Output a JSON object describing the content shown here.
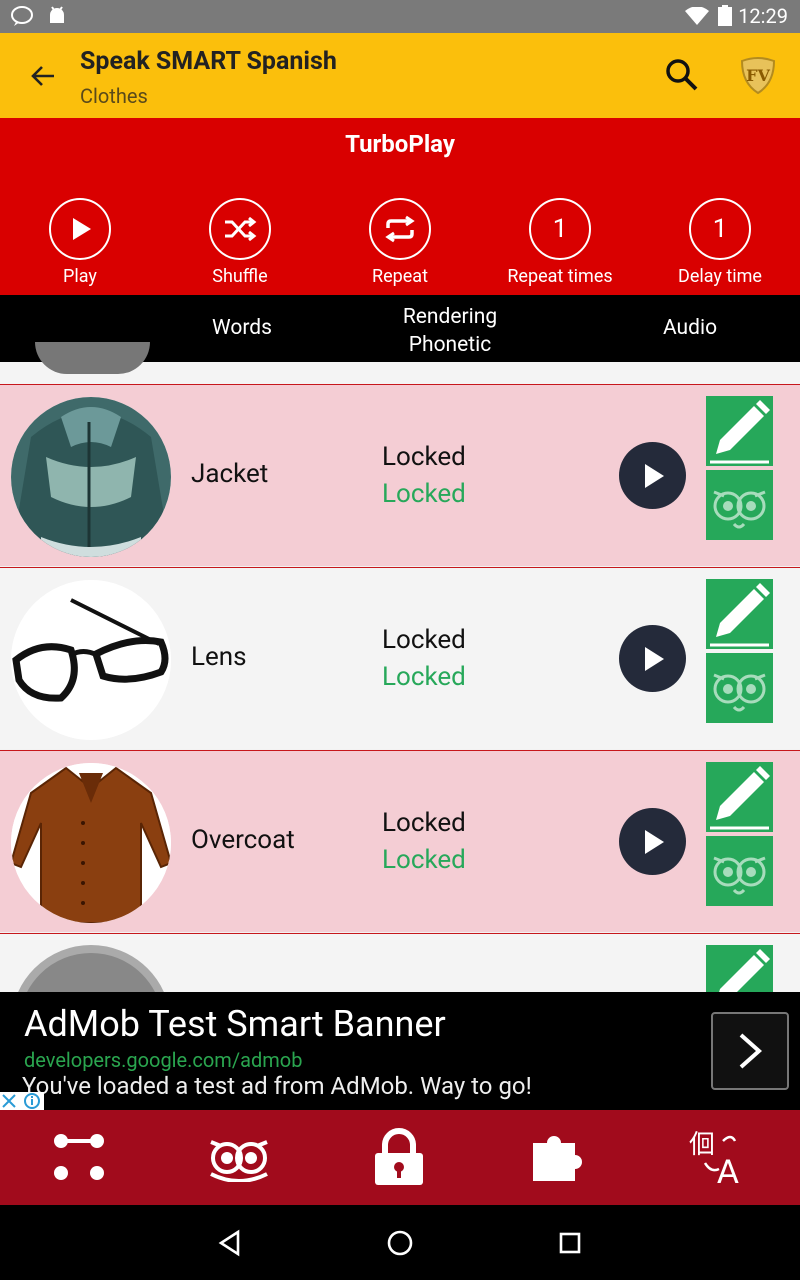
{
  "status": {
    "time": "12:29"
  },
  "appbar": {
    "title": "Speak SMART Spanish",
    "subtitle": "Clothes"
  },
  "turbo": {
    "title": "TurboPlay",
    "buttons": [
      {
        "label": "Play",
        "value": ""
      },
      {
        "label": "Shuffle",
        "value": ""
      },
      {
        "label": "Repeat",
        "value": ""
      },
      {
        "label": "Repeat times",
        "value": "1"
      },
      {
        "label": "Delay time",
        "value": "1"
      }
    ]
  },
  "columns": {
    "words": "Words",
    "rendering": "Rendering\nPhonetic",
    "audio": "Audio"
  },
  "rows": [
    {
      "word": "Jacket",
      "line1": "Locked",
      "line2": "Locked"
    },
    {
      "word": "Lens",
      "line1": "Locked",
      "line2": "Locked"
    },
    {
      "word": "Overcoat",
      "line1": "Locked",
      "line2": "Locked"
    }
  ],
  "ad": {
    "title": "AdMob Test Smart Banner",
    "url": "developers.google.com/admob",
    "desc": "You've loaded a test ad from AdMob. Way to go!"
  },
  "colors": {
    "appbar": "#fbbf0c",
    "turbo": "#d90000",
    "bottomnav": "#a10b1c",
    "accent_green": "#26a85a",
    "row_pink": "#f4cdd4"
  }
}
